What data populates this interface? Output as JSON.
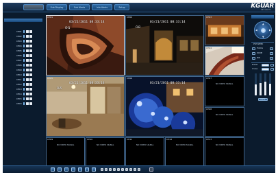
{
  "app": {
    "brand": {
      "main": "KGUAR",
      "sub": "SECURITY"
    },
    "accent": "#3a78b6",
    "background": "#0b1a2b"
  },
  "menu": {
    "items": [
      {
        "label": ""
      },
      {
        "label": "Sub Display"
      },
      {
        "label": "Sub Alerts"
      },
      {
        "label": "Info Alerts"
      },
      {
        "label": "Setup"
      }
    ]
  },
  "channels": {
    "items": [
      {
        "label": "CH01"
      },
      {
        "label": "CH02"
      },
      {
        "label": "CH03"
      },
      {
        "label": "CH04"
      },
      {
        "label": "CH05"
      },
      {
        "label": "CH06"
      },
      {
        "label": "CH07"
      },
      {
        "label": "CH08"
      },
      {
        "label": "CH09"
      },
      {
        "label": "CH10"
      },
      {
        "label": "CH11"
      },
      {
        "label": "CH12"
      },
      {
        "label": "CH13"
      },
      {
        "label": "CH14"
      },
      {
        "label": "CH15"
      },
      {
        "label": "CH16"
      }
    ]
  },
  "grid": {
    "cells": [
      {
        "label": "CH01",
        "timestamp": "03/21/2011 08:33:14",
        "tag": "CH1"
      },
      {
        "label": "CH02",
        "timestamp": "03/21/2011 08:33:14",
        "tag": "CH2"
      },
      {
        "label": "CH03",
        "timestamp": "",
        "tag": ""
      },
      {
        "label": "CH04",
        "timestamp": "",
        "tag": ""
      },
      {
        "label": "CH05",
        "timestamp": "03/21/2011 08:33:14",
        "tag": "CH5"
      },
      {
        "label": "CH06",
        "timestamp": "03/21/2011 08:33:14",
        "tag": ""
      },
      {
        "label": "CH07",
        "novideo": "NO VIDEO SIGNAL"
      },
      {
        "label": "CH08",
        "novideo": "NO VIDEO SIGNAL"
      },
      {
        "label": "CH09",
        "novideo": "NO VIDEO SIGNAL"
      },
      {
        "label": "CH10",
        "novideo": "NO VIDEO SIGNAL"
      },
      {
        "label": "CH11",
        "novideo": "NO VIDEO SIGNAL"
      },
      {
        "label": "CH12",
        "novideo": "NO VIDEO SIGNAL"
      },
      {
        "label": "CH13",
        "novideo": "NO VIDEO SIGNAL"
      }
    ]
  },
  "ptz": {
    "header": "",
    "speed_label": "PTZ SPEED",
    "controls": [
      {
        "label": "FOCUS"
      },
      {
        "label": "ZOOM"
      },
      {
        "label": "IRIS"
      }
    ],
    "preset_label": "Preset",
    "cruise_label": "Cruise",
    "apply_label": "Apply"
  },
  "bottombar": {
    "buttons": [
      "play-icon",
      "record-icon",
      "snapshot-icon",
      "mute-icon",
      "layout-1-icon",
      "layout-4-icon",
      "layout-9-icon",
      "layout-16-icon"
    ]
  }
}
